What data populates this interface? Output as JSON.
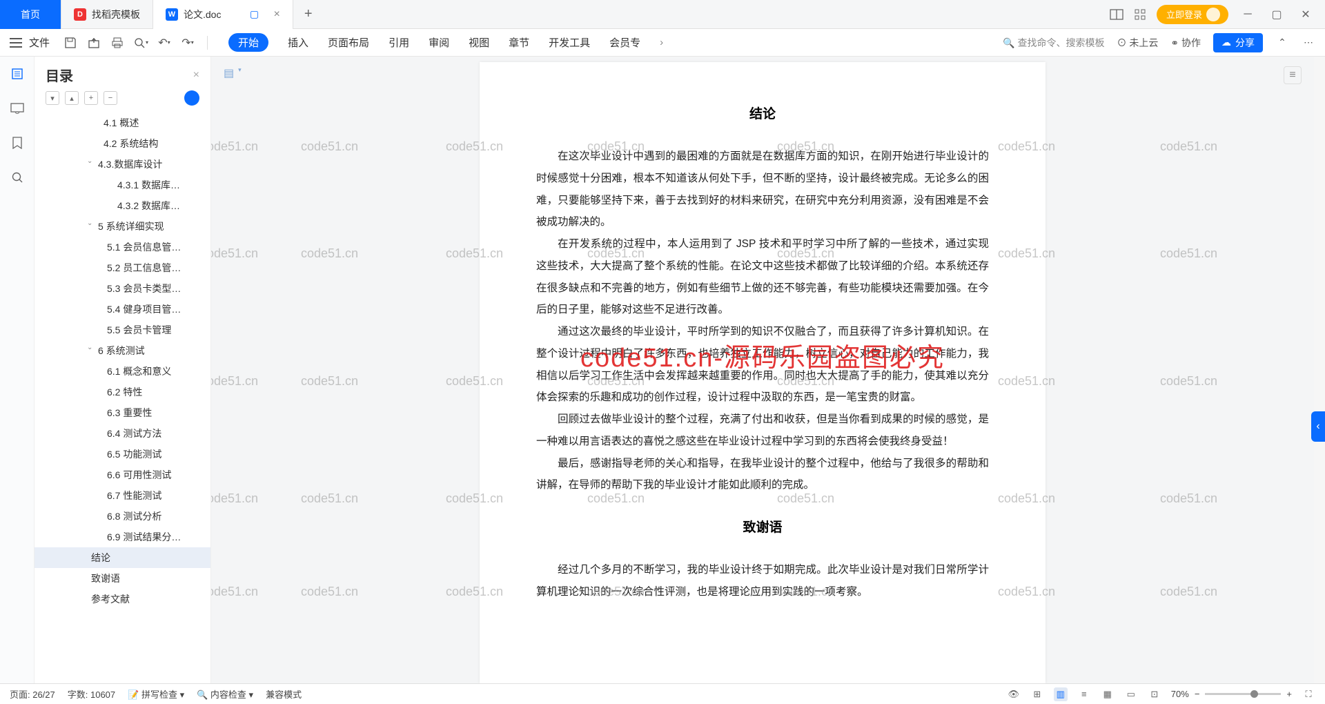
{
  "titlebar": {
    "home": "首页",
    "tab1": "找稻壳模板",
    "tab2": "论文.doc",
    "login": "立即登录"
  },
  "ribbon": {
    "file": "文件",
    "menu": [
      "开始",
      "插入",
      "页面布局",
      "引用",
      "审阅",
      "视图",
      "章节",
      "开发工具",
      "会员专"
    ],
    "search": "查找命令、搜索模板",
    "cloud": "未上云",
    "collab": "协作",
    "share": "分享"
  },
  "outline": {
    "title": "目录",
    "items": [
      {
        "t": "4.1 概述",
        "cls": "lv1"
      },
      {
        "t": "4.2 系统结构",
        "cls": "lv1"
      },
      {
        "t": "4.3.数据库设计",
        "cls": "lv0g",
        "c": 1
      },
      {
        "t": "4.3.1 数据库…",
        "cls": "lv1b"
      },
      {
        "t": "4.3.2 数据库…",
        "cls": "lv1b"
      },
      {
        "t": "5 系统详细实现",
        "cls": "lv0g",
        "c": 1
      },
      {
        "t": "5.1 会员信息管…",
        "cls": "lv2"
      },
      {
        "t": "5.2 员工信息管…",
        "cls": "lv2"
      },
      {
        "t": "5.3 会员卡类型…",
        "cls": "lv2"
      },
      {
        "t": "5.4 健身项目管…",
        "cls": "lv2"
      },
      {
        "t": "5.5 会员卡管理",
        "cls": "lv2"
      },
      {
        "t": "6 系统测试",
        "cls": "lv0g",
        "c": 1
      },
      {
        "t": "6.1 概念和意义",
        "cls": "lv2"
      },
      {
        "t": "6.2 特性",
        "cls": "lv2"
      },
      {
        "t": "6.3 重要性",
        "cls": "lv2"
      },
      {
        "t": "6.4 测试方法",
        "cls": "lv2"
      },
      {
        "t": "6.5 功能测试",
        "cls": "lv2"
      },
      {
        "t": "6.6 可用性测试",
        "cls": "lv2"
      },
      {
        "t": "6.7 性能测试",
        "cls": "lv2"
      },
      {
        "t": "6.8 测试分析",
        "cls": "lv2"
      },
      {
        "t": "6.9 测试结果分…",
        "cls": "lv2"
      },
      {
        "t": "结论",
        "cls": "lv0",
        "sel": 1
      },
      {
        "t": "致谢语",
        "cls": "lv0"
      },
      {
        "t": "参考文献",
        "cls": "lv0"
      }
    ]
  },
  "doc": {
    "h1": "结论",
    "p1": "在这次毕业设计中遇到的最困难的方面就是在数据库方面的知识，在刚开始进行毕业设计的时候感觉十分困难，根本不知道该从何处下手，但不断的坚持，设计最终被完成。无论多么的困难，只要能够坚持下来，善于去找到好的材料来研究，在研究中充分利用资源，没有困难是不会被成功解决的。",
    "p2": "在开发系统的过程中，本人运用到了 JSP 技术和平时学习中所了解的一些技术，通过实现这些技术，大大提高了整个系统的性能。在论文中这些技术都做了比较详细的介绍。本系统还存在很多缺点和不完善的地方，例如有些细节上做的还不够完善，有些功能模块还需要加强。在今后的日子里，能够对这些不足进行改善。",
    "p3": "通过这次最终的毕业设计，平时所学到的知识不仅融合了，而且获得了许多计算机知识。在整个设计过程中明白了许多东西，也培养独立工作能力，树立信心，对自己能力的工作能力，我相信以后学习工作生活中会发挥越来越重要的作用。同时也大大提高了手的能力，使其难以充分体会探索的乐趣和成功的创作过程，设计过程中汲取的东西，是一笔宝贵的财富。",
    "p4": "回顾过去做毕业设计的整个过程，充满了付出和收获，但是当你看到成果的时候的感觉，是一种难以用言语表达的喜悦之感这些在毕业设计过程中学习到的东西将会使我终身受益！",
    "p5": "最后，感谢指导老师的关心和指导，在我毕业设计的整个过程中，他给与了我很多的帮助和讲解，在导师的帮助下我的毕业设计才能如此顺利的完成。",
    "h2": "致谢语",
    "p6": "经过几个多月的不断学习，我的毕业设计终于如期完成。此次毕业设计是对我们日常所学计算机理论知识的一次综合性评测，也是将理论应用到实践的一项考察。"
  },
  "watermark": "code51.cn",
  "watermark_red": "code51.cn-源码乐园盗图必究",
  "status": {
    "page": "页面: 26/27",
    "words": "字数: 10607",
    "spell": "拼写检查",
    "content": "内容检查",
    "compat": "兼容模式",
    "zoom": "70%"
  }
}
